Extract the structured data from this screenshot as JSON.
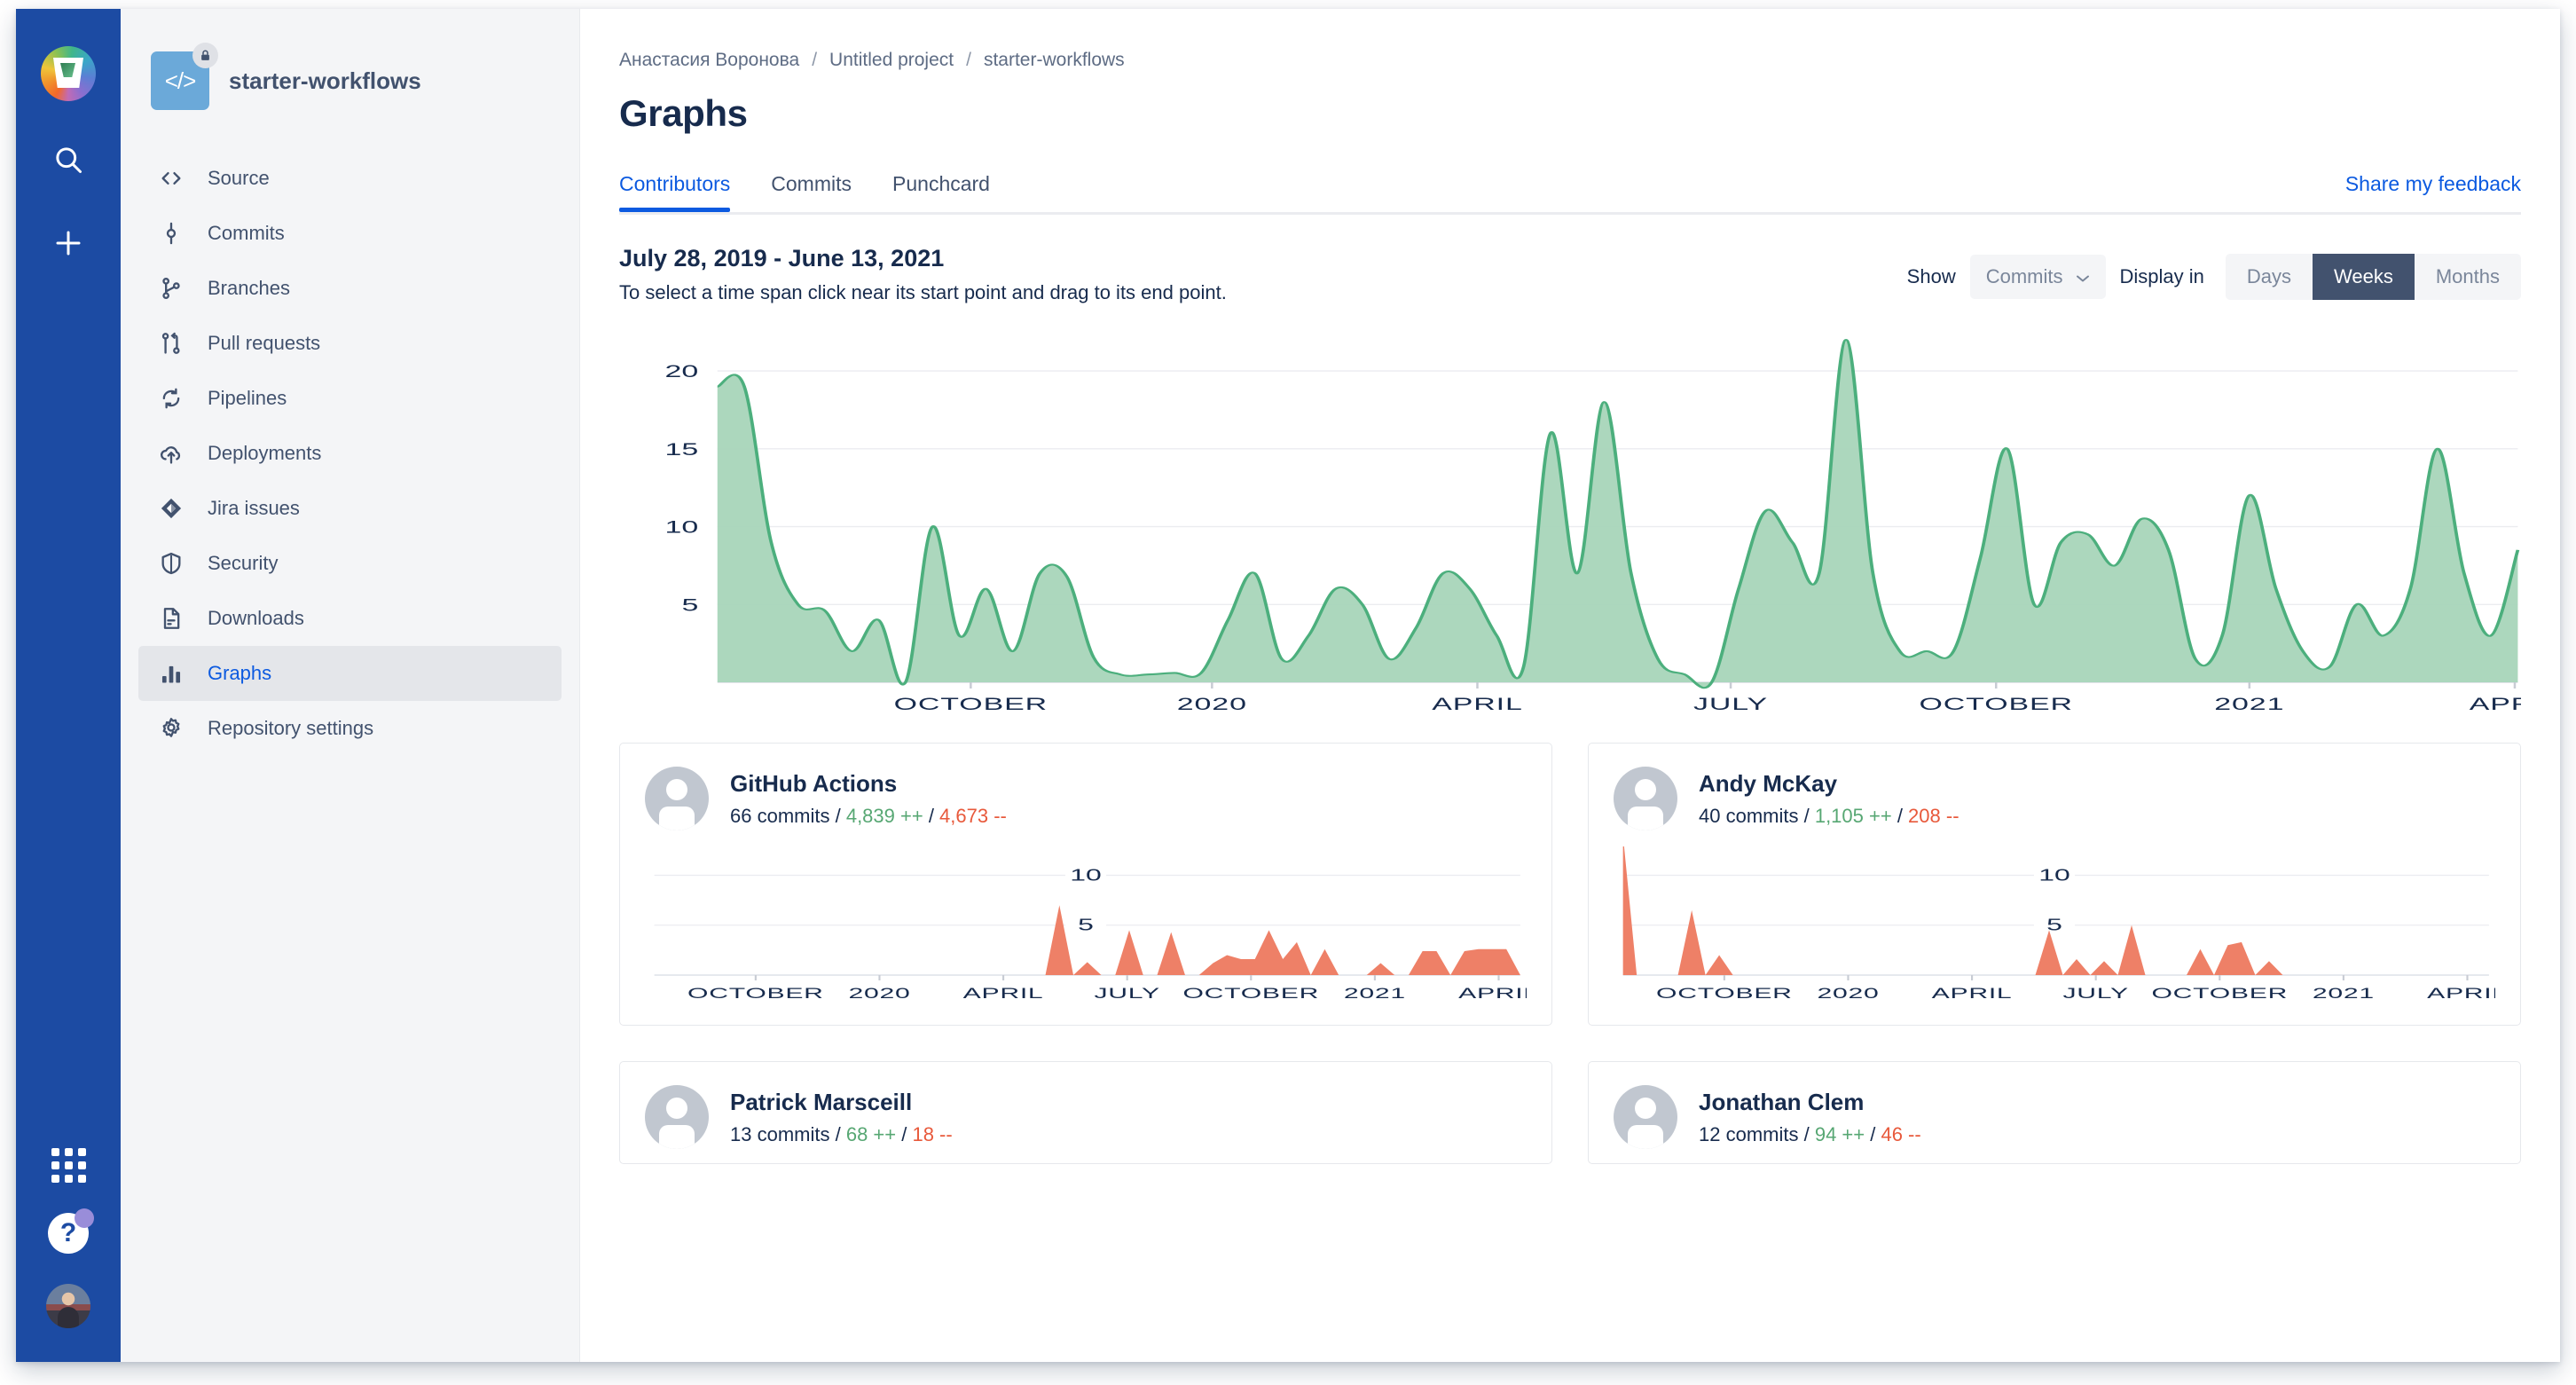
{
  "rail": {
    "logo_icon": "bitbucket-logo",
    "search_icon": "search-icon",
    "create_icon": "plus-icon",
    "apps_icon": "app-switcher-icon",
    "help_icon": "help-icon",
    "help_label": "?",
    "avatar_icon": "user-avatar"
  },
  "sidebar": {
    "repo_name": "starter-workflows",
    "repo_avatar_glyph": "</>",
    "repo_lock_icon": "lock-icon",
    "items": [
      {
        "label": "Source",
        "icon": "code-icon",
        "active": false
      },
      {
        "label": "Commits",
        "icon": "commit-icon",
        "active": false
      },
      {
        "label": "Branches",
        "icon": "branch-icon",
        "active": false
      },
      {
        "label": "Pull requests",
        "icon": "pull-request-icon",
        "active": false
      },
      {
        "label": "Pipelines",
        "icon": "pipelines-icon",
        "active": false
      },
      {
        "label": "Deployments",
        "icon": "deployments-cloud-icon",
        "active": false
      },
      {
        "label": "Jira issues",
        "icon": "jira-icon",
        "active": false
      },
      {
        "label": "Security",
        "icon": "shield-icon",
        "active": false
      },
      {
        "label": "Downloads",
        "icon": "file-download-icon",
        "active": false
      },
      {
        "label": "Graphs",
        "icon": "bar-chart-icon",
        "active": true
      },
      {
        "label": "Repository settings",
        "icon": "gear-icon",
        "active": false
      }
    ]
  },
  "header": {
    "breadcrumb": [
      "Анастасия Воронова",
      "Untitled project",
      "starter-workflows"
    ],
    "separator": "/",
    "title": "Graphs"
  },
  "tabs": [
    {
      "label": "Contributors",
      "active": true
    },
    {
      "label": "Commits",
      "active": false
    },
    {
      "label": "Punchcard",
      "active": false
    }
  ],
  "feedback_link": "Share my feedback",
  "controls": {
    "range_title": "July 28, 2019 - June 13, 2021",
    "range_hint": "To select a time span click near its start point and drag to its end point.",
    "show_label": "Show",
    "show_value": "Commits",
    "show_caret": "chevron-down-icon",
    "display_label": "Display in",
    "display_options": [
      {
        "label": "Days",
        "active": false
      },
      {
        "label": "Weeks",
        "active": true
      },
      {
        "label": "Months",
        "active": false
      }
    ]
  },
  "colors": {
    "green_fill": "#a8d5b9",
    "green_stroke": "#4caf7d",
    "orange_fill": "#ee8067",
    "accent_blue": "#0c5ae0",
    "rail_blue": "#1c4ba3",
    "navy": "#42526e"
  },
  "chart_data": [
    {
      "id": "main-commits-chart",
      "type": "area",
      "title": "July 28, 2019 - June 13, 2021",
      "xlabel": "",
      "ylabel": "",
      "ylim": [
        0,
        22
      ],
      "yticks": [
        5,
        10,
        15,
        20
      ],
      "grid": true,
      "xticks": [
        "OCTOBER",
        "2020",
        "APRIL",
        "JULY",
        "OCTOBER",
        "2021",
        "APRIL"
      ],
      "xtick_positions": [
        0.105,
        0.205,
        0.315,
        0.42,
        0.53,
        0.635,
        0.745
      ],
      "series": [
        {
          "name": "Commits",
          "values": [
            19,
            19,
            9,
            5,
            4.6,
            2,
            4,
            0,
            10,
            3,
            6,
            2,
            7,
            6.8,
            1.6,
            0.5,
            0.5,
            0.6,
            0.6,
            4,
            7,
            1.5,
            3,
            6,
            5,
            1.5,
            3.5,
            7,
            6,
            3,
            1,
            16,
            7,
            18,
            7,
            1.5,
            0.5,
            0,
            6,
            11,
            9,
            7,
            22,
            7,
            2,
            2,
            2,
            8,
            15,
            5,
            9,
            9.5,
            7.5,
            10.5,
            8.5,
            1.5,
            3,
            12,
            6,
            2,
            1,
            5,
            3,
            6,
            15,
            7,
            3,
            8.5
          ]
        }
      ]
    },
    {
      "id": "github-actions-chart",
      "type": "area",
      "ylim": [
        0,
        12
      ],
      "yticks": [
        5,
        10
      ],
      "xticks": [
        "OCTOBER",
        "2020",
        "APRIL",
        "JULY",
        "OCTOBER",
        "2021",
        "APRIL"
      ],
      "xtick_positions": [
        0.09,
        0.2,
        0.31,
        0.42,
        0.53,
        0.64,
        0.75
      ],
      "series": [
        {
          "name": "Commits",
          "values": [
            0,
            0,
            0,
            0,
            0,
            0,
            0,
            0,
            0,
            0,
            0,
            0,
            0,
            0,
            0,
            0,
            0,
            0,
            0,
            0,
            0,
            0,
            0,
            0,
            0,
            0,
            0,
            0,
            0,
            7,
            0,
            1.3,
            0,
            0,
            4.5,
            0,
            0,
            4.3,
            0,
            0,
            1.2,
            2,
            1.6,
            1.6,
            4.5,
            1.6,
            3.3,
            0,
            2.6,
            0,
            0,
            0,
            1.2,
            0,
            0,
            2.4,
            2.4,
            0,
            2.4,
            2.6,
            2.6,
            2.6,
            0
          ]
        }
      ]
    },
    {
      "id": "andy-mckay-chart",
      "type": "area",
      "ylim": [
        0,
        12
      ],
      "yticks": [
        5,
        10
      ],
      "xticks": [
        "OCTOBER",
        "2020",
        "APRIL",
        "JULY",
        "OCTOBER",
        "2021",
        "APRIL"
      ],
      "xtick_positions": [
        0.09,
        0.2,
        0.31,
        0.42,
        0.53,
        0.64,
        0.75
      ],
      "series": [
        {
          "name": "Commits",
          "values": [
            14,
            0,
            0,
            0,
            0,
            6.5,
            0,
            2,
            0,
            0,
            0,
            0,
            0,
            0,
            0,
            0,
            0,
            0,
            0,
            0,
            0,
            0,
            0,
            0,
            0,
            0,
            0,
            0,
            0,
            0,
            0,
            4.5,
            0,
            1.6,
            0,
            1.4,
            0,
            5,
            0,
            0,
            0,
            0,
            2.6,
            0,
            3,
            3.3,
            0,
            1.4,
            0,
            0,
            0,
            0,
            0,
            0,
            0,
            0,
            0,
            0,
            0,
            0,
            0,
            0,
            0,
            0
          ]
        }
      ]
    }
  ],
  "contributors": [
    {
      "name": "GitHub Actions",
      "commits": "66 commits",
      "additions": "4,839 ++",
      "deletions": "4,673 --",
      "chart_id": "github-actions-chart"
    },
    {
      "name": "Andy McKay",
      "commits": "40 commits",
      "additions": "1,105 ++",
      "deletions": "208 --",
      "chart_id": "andy-mckay-chart"
    },
    {
      "name": "Patrick Marsceill",
      "commits": "13 commits",
      "additions": "68 ++",
      "deletions": "18 --",
      "chart_id": ""
    },
    {
      "name": "Jonathan Clem",
      "commits": "12 commits",
      "additions": "94 ++",
      "deletions": "46 --",
      "chart_id": ""
    }
  ]
}
